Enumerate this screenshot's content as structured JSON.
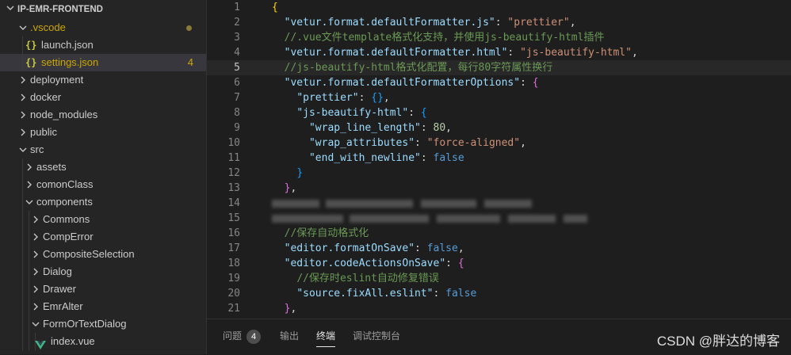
{
  "explorer": {
    "root": "IP-EMR-FRONTEND",
    "items": [
      {
        "label": ".vscode",
        "depth": 1,
        "type": "folder-open",
        "color": "#cca700",
        "modified_dot": true
      },
      {
        "label": "launch.json",
        "depth": 2,
        "type": "json"
      },
      {
        "label": "settings.json",
        "depth": 2,
        "type": "json",
        "color": "#cca700",
        "badge": "4",
        "selected": true
      },
      {
        "label": "deployment",
        "depth": 1,
        "type": "folder"
      },
      {
        "label": "docker",
        "depth": 1,
        "type": "folder"
      },
      {
        "label": "node_modules",
        "depth": 1,
        "type": "folder"
      },
      {
        "label": "public",
        "depth": 1,
        "type": "folder"
      },
      {
        "label": "src",
        "depth": 1,
        "type": "folder-open"
      },
      {
        "label": "assets",
        "depth": 2,
        "type": "folder"
      },
      {
        "label": "comonClass",
        "depth": 2,
        "type": "folder"
      },
      {
        "label": "components",
        "depth": 2,
        "type": "folder-open"
      },
      {
        "label": "Commons",
        "depth": 3,
        "type": "folder"
      },
      {
        "label": "CompError",
        "depth": 3,
        "type": "folder"
      },
      {
        "label": "CompositeSelection",
        "depth": 3,
        "type": "folder"
      },
      {
        "label": "Dialog",
        "depth": 3,
        "type": "folder"
      },
      {
        "label": "Drawer",
        "depth": 3,
        "type": "folder"
      },
      {
        "label": "EmrAlter",
        "depth": 3,
        "type": "folder"
      },
      {
        "label": "FormOrTextDialog",
        "depth": 3,
        "type": "folder-open"
      },
      {
        "label": "index.vue",
        "depth": 4,
        "type": "vue"
      }
    ]
  },
  "editor": {
    "current_line": 5,
    "lines": [
      {
        "n": "1",
        "t": [
          [
            "br1",
            "{"
          ]
        ]
      },
      {
        "n": "2",
        "t": [
          [
            "p",
            "  "
          ],
          [
            "k",
            "\"vetur.format.defaultFormatter.js\""
          ],
          [
            "p",
            ": "
          ],
          [
            "s",
            "\"prettier\""
          ],
          [
            "p",
            ","
          ]
        ]
      },
      {
        "n": "3",
        "t": [
          [
            "p",
            "  "
          ],
          [
            "c",
            "//.vue文件template格式化支持，并使用js-beautify-html插件"
          ]
        ]
      },
      {
        "n": "4",
        "t": [
          [
            "p",
            "  "
          ],
          [
            "k",
            "\"vetur.format.defaultFormatter.html\""
          ],
          [
            "p",
            ": "
          ],
          [
            "s",
            "\"js-beautify-html\""
          ],
          [
            "p",
            ","
          ]
        ]
      },
      {
        "n": "5",
        "t": [
          [
            "p",
            "  "
          ],
          [
            "c",
            "//js-beautify-html格式化配置，每行80字符属性换行"
          ]
        ]
      },
      {
        "n": "6",
        "t": [
          [
            "p",
            "  "
          ],
          [
            "k",
            "\"vetur.format.defaultFormatterOptions\""
          ],
          [
            "p",
            ": "
          ],
          [
            "br2",
            "{"
          ]
        ]
      },
      {
        "n": "7",
        "t": [
          [
            "p",
            "    "
          ],
          [
            "k",
            "\"prettier\""
          ],
          [
            "p",
            ": "
          ],
          [
            "br3",
            "{}"
          ],
          [
            "p",
            ","
          ]
        ]
      },
      {
        "n": "8",
        "t": [
          [
            "p",
            "    "
          ],
          [
            "k",
            "\"js-beautify-html\""
          ],
          [
            "p",
            ": "
          ],
          [
            "br3",
            "{"
          ]
        ]
      },
      {
        "n": "9",
        "t": [
          [
            "p",
            "      "
          ],
          [
            "k",
            "\"wrap_line_length\""
          ],
          [
            "p",
            ": "
          ],
          [
            "n",
            "80"
          ],
          [
            "p",
            ","
          ]
        ]
      },
      {
        "n": "10",
        "t": [
          [
            "p",
            "      "
          ],
          [
            "k",
            "\"wrap_attributes\""
          ],
          [
            "p",
            ": "
          ],
          [
            "s",
            "\"force-aligned\""
          ],
          [
            "p",
            ","
          ]
        ]
      },
      {
        "n": "11",
        "t": [
          [
            "p",
            "      "
          ],
          [
            "k",
            "\"end_with_newline\""
          ],
          [
            "p",
            ": "
          ],
          [
            "b",
            "false"
          ]
        ]
      },
      {
        "n": "12",
        "t": [
          [
            "p",
            "    "
          ],
          [
            "br3",
            "}"
          ]
        ]
      },
      {
        "n": "13",
        "t": [
          [
            "p",
            "  "
          ],
          [
            "br2",
            "}"
          ],
          [
            "p",
            ","
          ]
        ]
      },
      {
        "n": "14",
        "t": [],
        "blurred": true
      },
      {
        "n": "15",
        "t": [],
        "blurred": true
      },
      {
        "n": "16",
        "t": [
          [
            "p",
            "  "
          ],
          [
            "c",
            "//保存自动格式化"
          ]
        ]
      },
      {
        "n": "17",
        "t": [
          [
            "p",
            "  "
          ],
          [
            "k",
            "\"editor.formatOnSave\""
          ],
          [
            "p",
            ": "
          ],
          [
            "b",
            "false"
          ],
          [
            "p",
            ","
          ]
        ]
      },
      {
        "n": "18",
        "t": [
          [
            "p",
            "  "
          ],
          [
            "k",
            "\"editor.codeActionsOnSave\""
          ],
          [
            "p",
            ": "
          ],
          [
            "br2",
            "{"
          ]
        ]
      },
      {
        "n": "19",
        "t": [
          [
            "p",
            "    "
          ],
          [
            "c",
            "//保存时eslint自动修复错误"
          ]
        ]
      },
      {
        "n": "20",
        "t": [
          [
            "p",
            "    "
          ],
          [
            "k",
            "\"source.fixAll.eslint\""
          ],
          [
            "p",
            ": "
          ],
          [
            "b",
            "false"
          ]
        ]
      },
      {
        "n": "21",
        "t": [
          [
            "p",
            "  "
          ],
          [
            "br2",
            "}"
          ],
          [
            "p",
            ","
          ]
        ]
      }
    ]
  },
  "panel": {
    "tabs": [
      {
        "label": "问题",
        "count": "4",
        "active": false
      },
      {
        "label": "输出",
        "active": false
      },
      {
        "label": "终端",
        "active": true
      },
      {
        "label": "调试控制台",
        "active": false
      }
    ]
  },
  "watermark": "CSDN @胖达的博客"
}
